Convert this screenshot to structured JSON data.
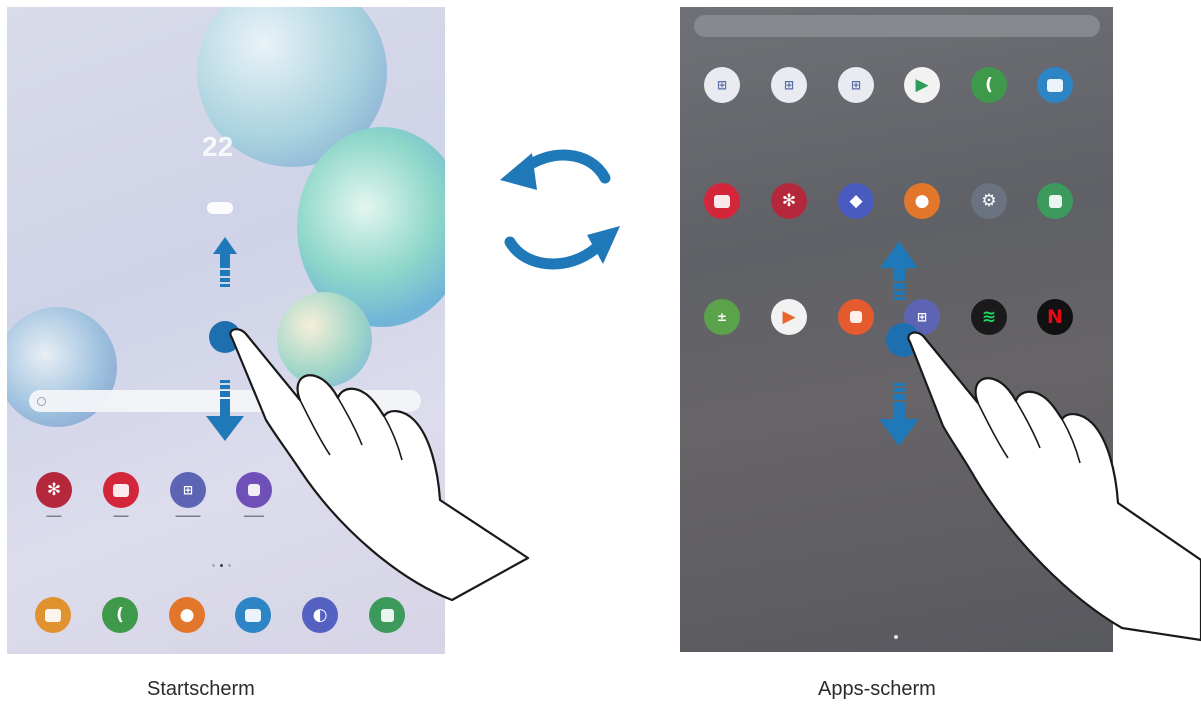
{
  "captions": {
    "home": "Startscherm",
    "apps": "Apps-scherm"
  },
  "home_screen": {
    "clock_text": "22",
    "weather_icon": "cloud-icon",
    "favorites_row": [
      {
        "icon": "gallery-flower-icon",
        "color": "#b5283b"
      },
      {
        "icon": "camera-icon",
        "color": "#d3263b"
      },
      {
        "icon": "apps-folder-icon",
        "color": "#5d64b4"
      },
      {
        "icon": "galaxy-store-bag-icon",
        "color": "#6f4fb8"
      }
    ],
    "dock": [
      {
        "icon": "email-icon",
        "color": "#e0922f"
      },
      {
        "icon": "phone-icon",
        "color": "#3e9a4a"
      },
      {
        "icon": "contacts-icon",
        "color": "#e2762a"
      },
      {
        "icon": "messages-icon",
        "color": "#2d85c6"
      },
      {
        "icon": "internet-icon",
        "color": "#5461c1"
      },
      {
        "icon": "calendar-icon",
        "color": "#3b9a5c"
      }
    ]
  },
  "apps_screen": {
    "rows": [
      [
        {
          "icon": "google-folder-icon",
          "color": "#e9ebf0"
        },
        {
          "icon": "google-folder-icon",
          "color": "#e9ebf0"
        },
        {
          "icon": "microsoft-folder-icon",
          "color": "#e9ebf0"
        },
        {
          "icon": "play-store-icon",
          "color": "#f2f2f2"
        },
        {
          "icon": "phone-icon",
          "color": "#3e9a4a"
        },
        {
          "icon": "messages-icon",
          "color": "#2d85c6"
        }
      ],
      [
        {
          "icon": "camera-icon",
          "color": "#d3263b"
        },
        {
          "icon": "gallery-flower-icon",
          "color": "#b5283b"
        },
        {
          "icon": "bixby-icon",
          "color": "#4a5bc0"
        },
        {
          "icon": "contacts-icon",
          "color": "#e2762a"
        },
        {
          "icon": "settings-icon",
          "color": "#6b7380"
        },
        {
          "icon": "calendar-icon",
          "color": "#3b9a5c"
        }
      ],
      [
        {
          "icon": "calculator-icon",
          "color": "#5aa34a"
        },
        {
          "icon": "play-movies-icon",
          "color": "#f2f2f2"
        },
        {
          "icon": "notes-icon",
          "color": "#e55a2e"
        },
        {
          "icon": "apps-folder-icon",
          "color": "#5d64b4"
        },
        {
          "icon": "spotify-icon",
          "color": "#1a1a1a"
        },
        {
          "icon": "netflix-icon",
          "color": "#111111"
        }
      ]
    ]
  },
  "colors": {
    "arrow_blue": "#1f79b8",
    "touch_dot": "#1d6fb0"
  },
  "decor": {
    "rotate_arrows_icon": "rotate-arrows-icon",
    "hand_icon": "pointing-hand-icon",
    "swipe_up_icon": "swipe-up-arrow-icon",
    "swipe_down_icon": "swipe-down-arrow-icon"
  }
}
